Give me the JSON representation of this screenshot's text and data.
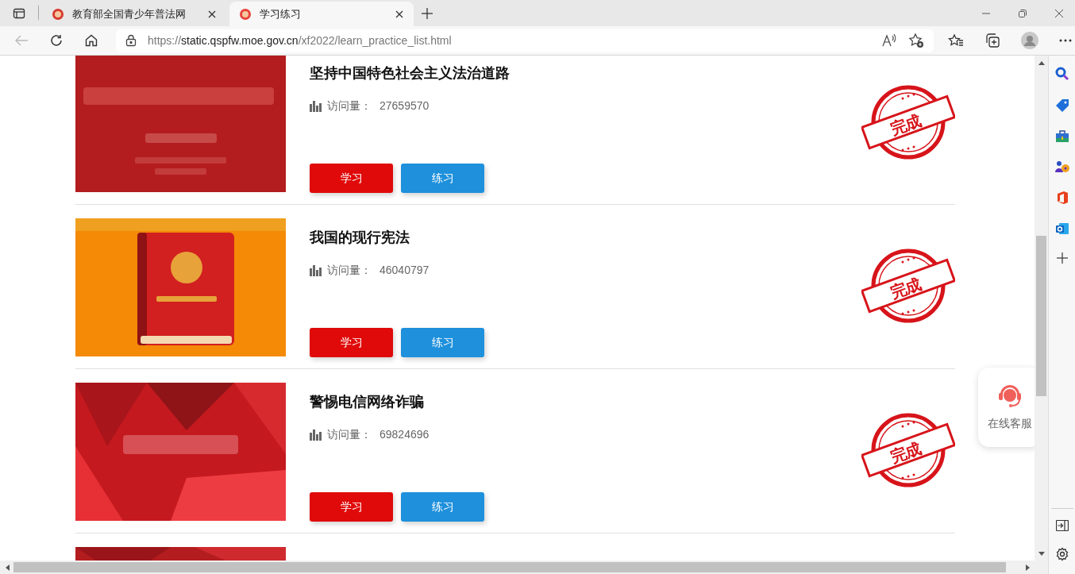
{
  "browser": {
    "tabs": [
      {
        "title": "教育部全国青少年普法网",
        "selected": false
      },
      {
        "title": "学习练习",
        "selected": true
      }
    ],
    "address": {
      "scheme": "https://",
      "host": "static.qspfw.moe.gov.cn",
      "path": "/xf2022/learn_practice_list.html"
    }
  },
  "items": [
    {
      "title": "坚持中国特色社会主义法治道路",
      "visits_label": "访问量：",
      "visits": "27659570",
      "buttons": [
        "学习",
        "练习"
      ],
      "stamp": "完成"
    },
    {
      "title": "我国的现行宪法",
      "visits_label": "访问量：",
      "visits": "46040797",
      "buttons": [
        "学习",
        "练习"
      ],
      "stamp": "完成"
    },
    {
      "title": "警惕电信网络诈骗",
      "visits_label": "访问量：",
      "visits": "69824696",
      "buttons": [
        "学习",
        "练习"
      ],
      "stamp": "完成"
    }
  ],
  "service": {
    "label": "在线客服"
  }
}
